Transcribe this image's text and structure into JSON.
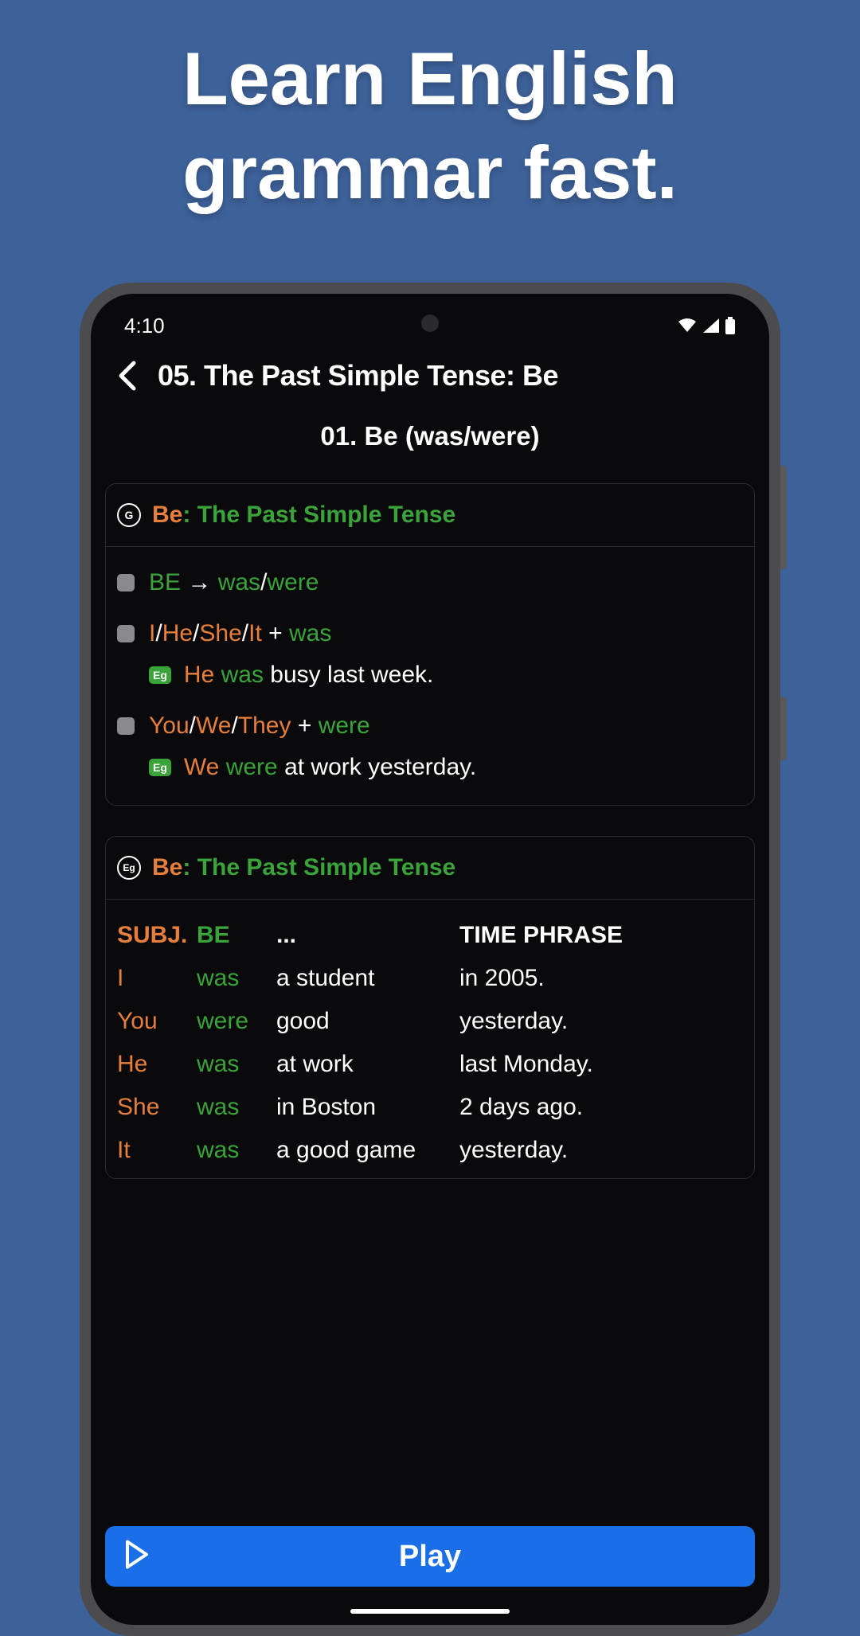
{
  "promo": {
    "title": "Learn English grammar fast."
  },
  "status": {
    "time": "4:10"
  },
  "header": {
    "title": "05. The Past Simple Tense: Be"
  },
  "subtitle": "01. Be (was/were)",
  "grammar_card": {
    "badge": "G",
    "title_be": "Be",
    "title_sep": ": ",
    "title_rest": "The Past Simple Tense",
    "rules": [
      {
        "parts": [
          {
            "t": "BE",
            "c": "green"
          },
          {
            "t": " → ",
            "c": "white"
          },
          {
            "t": "was",
            "c": "green"
          },
          {
            "t": "/",
            "c": "white"
          },
          {
            "t": "were",
            "c": "green"
          }
        ],
        "example": null
      },
      {
        "parts": [
          {
            "t": "I",
            "c": "orange"
          },
          {
            "t": "/",
            "c": "white"
          },
          {
            "t": "He",
            "c": "orange"
          },
          {
            "t": "/",
            "c": "white"
          },
          {
            "t": "She",
            "c": "orange"
          },
          {
            "t": "/",
            "c": "white"
          },
          {
            "t": "It",
            "c": "orange"
          },
          {
            "t": " + ",
            "c": "white"
          },
          {
            "t": "was",
            "c": "green"
          }
        ],
        "example": [
          {
            "t": "He",
            "c": "orange"
          },
          {
            "t": " ",
            "c": "white"
          },
          {
            "t": "was",
            "c": "green"
          },
          {
            "t": " busy last week.",
            "c": "white"
          }
        ]
      },
      {
        "parts": [
          {
            "t": "You",
            "c": "orange"
          },
          {
            "t": "/",
            "c": "white"
          },
          {
            "t": "We",
            "c": "orange"
          },
          {
            "t": "/",
            "c": "white"
          },
          {
            "t": "They",
            "c": "orange"
          },
          {
            "t": " + ",
            "c": "white"
          },
          {
            "t": "were",
            "c": "green"
          }
        ],
        "example": [
          {
            "t": "We",
            "c": "orange"
          },
          {
            "t": " ",
            "c": "white"
          },
          {
            "t": "were",
            "c": "green"
          },
          {
            "t": " at work yesterday.",
            "c": "white"
          }
        ]
      }
    ]
  },
  "example_card": {
    "badge": "Eg",
    "title_be": "Be",
    "title_sep": ": ",
    "title_rest": "The Past Simple Tense",
    "headers": {
      "subj": "SUBJ.",
      "be": "BE",
      "mid": "...",
      "time": "TIME PHRASE"
    },
    "rows": [
      {
        "subj": "I",
        "be": "was",
        "mid": "a student",
        "time": "in 2005."
      },
      {
        "subj": "You",
        "be": "were",
        "mid": "good",
        "time": "yesterday."
      },
      {
        "subj": "He",
        "be": "was",
        "mid": "at work",
        "time": "last Monday."
      },
      {
        "subj": "She",
        "be": "was",
        "mid": "in Boston",
        "time": "2 days ago."
      },
      {
        "subj": "It",
        "be": "was",
        "mid": "a good game",
        "time": "yesterday."
      }
    ]
  },
  "play": {
    "label": "Play"
  },
  "eg_label": "Eg"
}
